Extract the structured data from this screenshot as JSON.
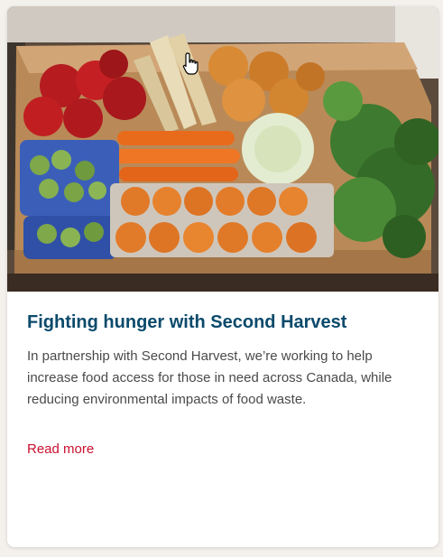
{
  "card": {
    "image_alt": "Box of fresh produce, eggs and apples",
    "title": "Fighting hunger with Second Harvest",
    "description": "In partnership with Second Harvest, we’re working to help increase food access for those in need across Canada, while reducing environmental impacts of food waste.",
    "read_more_label": "Read more",
    "colors": {
      "title": "#0b4a6b",
      "link": "#c8102e",
      "text": "#4a4a4a",
      "page_bg": "#f4f1ed"
    }
  },
  "cursor": {
    "icon": "hand-pointer-icon"
  }
}
